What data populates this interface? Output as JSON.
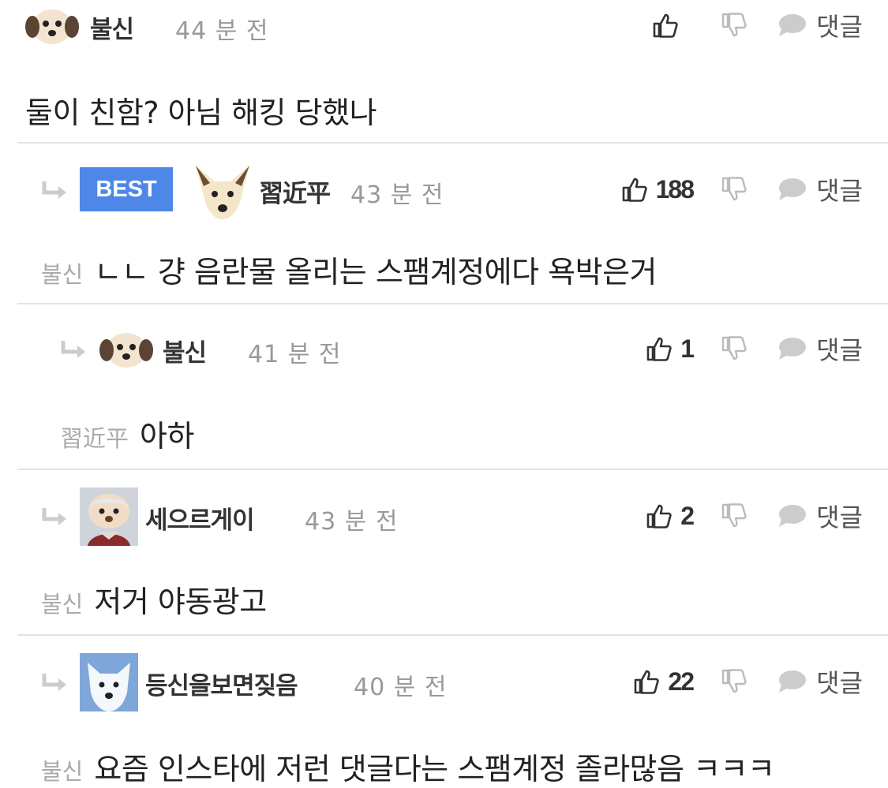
{
  "comments": [
    {
      "username": "불신",
      "time": "44 분 전",
      "like_count": "",
      "reply_label": "댓글",
      "mention": "",
      "text": "둘이 친함? 아님 해킹 당했나",
      "avatar_icon": "puppy-avatar-icon",
      "is_reply": false,
      "best": false
    },
    {
      "badge": "BEST",
      "username": "習近平",
      "time": "43 분 전",
      "like_count": "188",
      "reply_label": "댓글",
      "mention": "불신",
      "text": "ㄴㄴ 걍 음란물 올리는 스팸계정에다 욕박은거",
      "avatar_icon": "dog-avatar-icon",
      "is_reply": true,
      "best": true
    },
    {
      "username": "불신",
      "time": "41 분 전",
      "like_count": "1",
      "reply_label": "댓글",
      "mention": "習近平",
      "text": "아하",
      "avatar_icon": "puppy-avatar-icon",
      "is_reply": true,
      "best": false
    },
    {
      "username": "세으르게이",
      "time": "43 분 전",
      "like_count": "2",
      "reply_label": "댓글",
      "mention": "불신",
      "text": "저거 야동광고",
      "avatar_icon": "photo-avatar-icon",
      "is_reply": true,
      "best": false
    },
    {
      "username": "등신을보면짖음",
      "time": "40 분 전",
      "like_count": "22",
      "reply_label": "댓글",
      "mention": "불신",
      "text": "요즘 인스타에 저런 댓글다는 스팸계정 졸라많음 ㅋㅋㅋ",
      "avatar_icon": "white-dog-avatar-icon",
      "is_reply": true,
      "best": false
    }
  ],
  "colors": {
    "best_badge": "#4f87e8",
    "divider": "#e3e3e3",
    "muted_text": "#999999"
  }
}
